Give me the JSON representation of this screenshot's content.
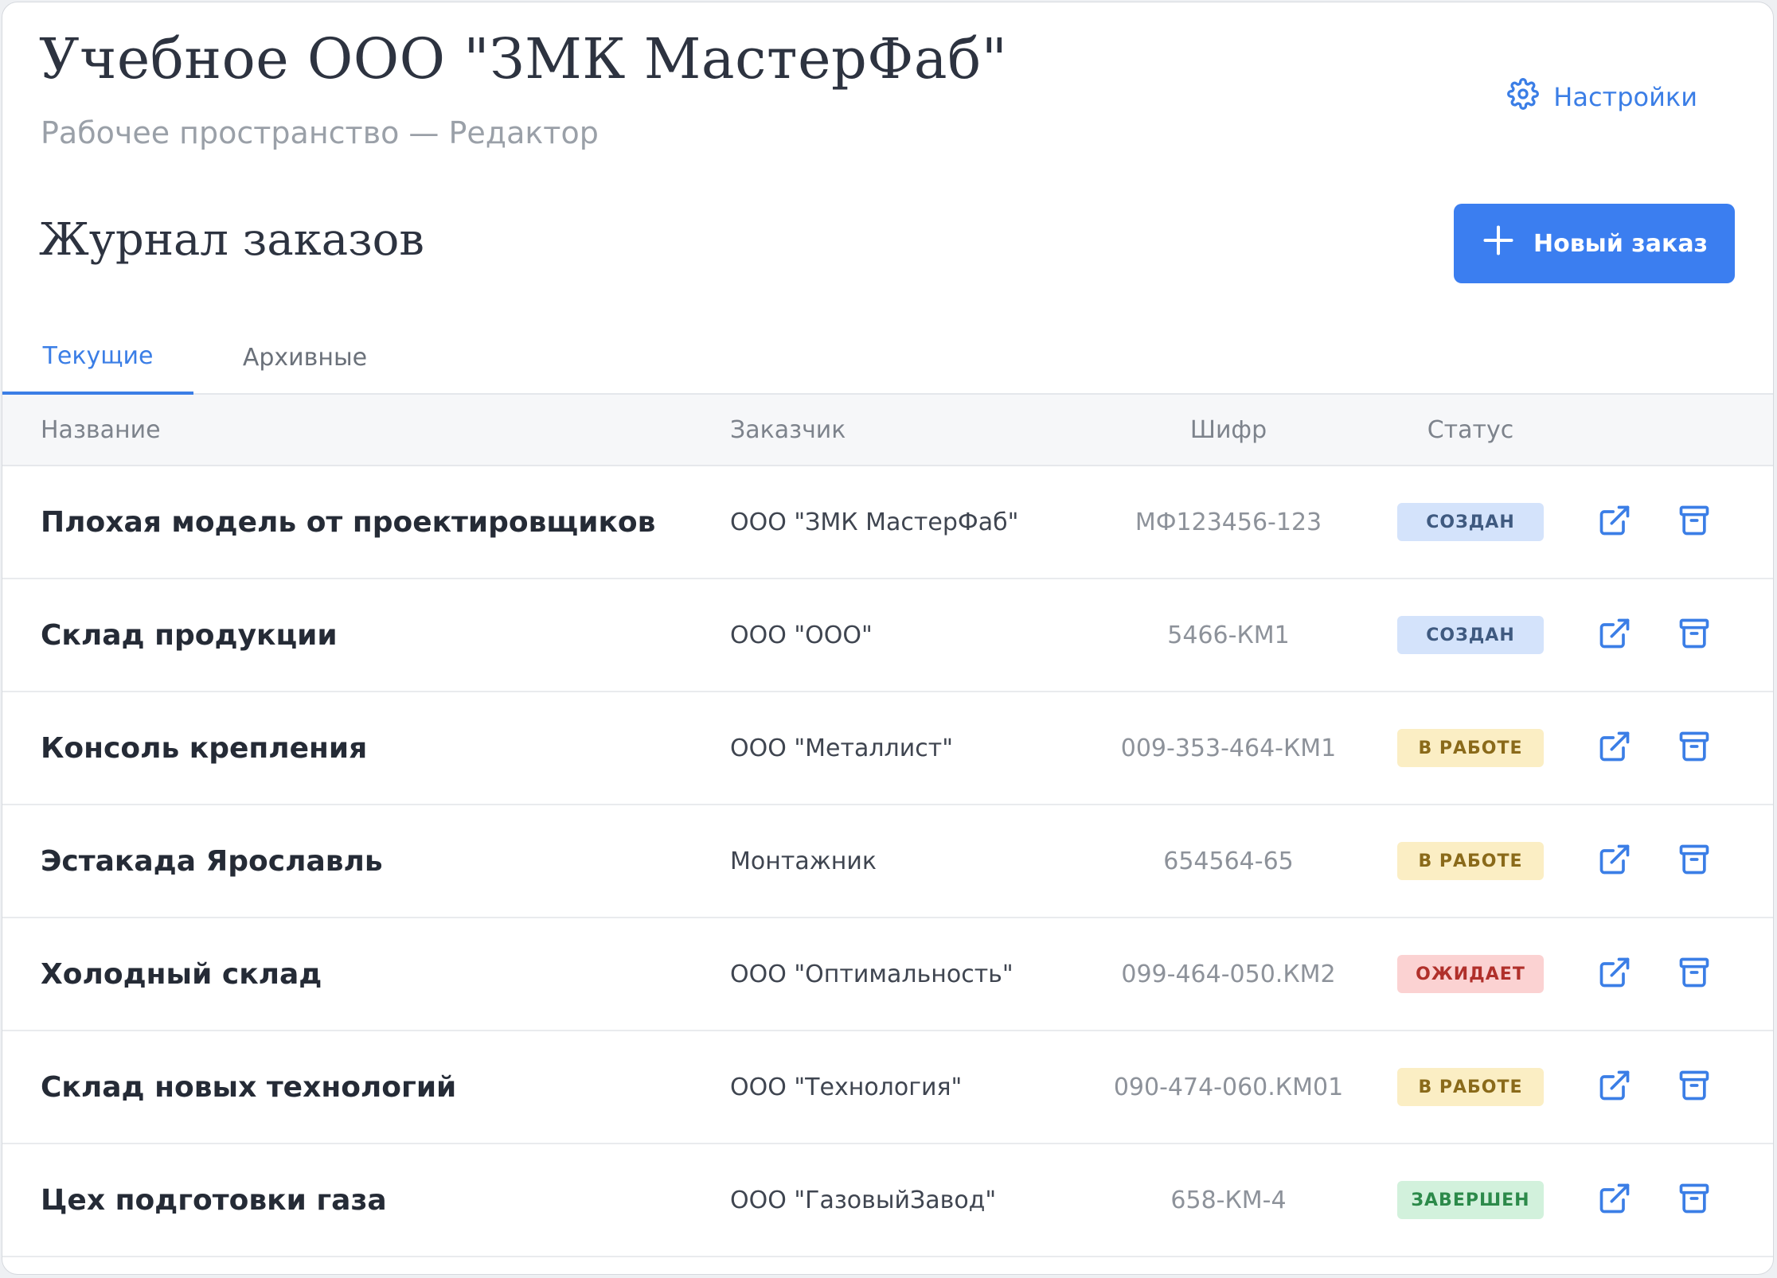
{
  "header": {
    "title": "Учебное ООО \"ЗМК МастерФаб\"",
    "subtitle": "Рабочее пространство — Редактор",
    "settings_label": "Настройки"
  },
  "section": {
    "title": "Журнал заказов",
    "new_order_label": "Новый заказ"
  },
  "tabs": [
    {
      "label": "Текущие",
      "active": true
    },
    {
      "label": "Архивные",
      "active": false
    }
  ],
  "table": {
    "columns": [
      "Название",
      "Заказчик",
      "Шифр",
      "Статус"
    ],
    "rows": [
      {
        "name": "Плохая модель от проектировщиков",
        "customer": "ООО \"ЗМК МастерФаб\"",
        "code": "МФ123456-123",
        "status": "СОЗДАН",
        "status_kind": "created"
      },
      {
        "name": "Склад продукции",
        "customer": "ООО \"ООО\"",
        "code": "5466-КМ1",
        "status": "СОЗДАН",
        "status_kind": "created"
      },
      {
        "name": "Консоль крепления",
        "customer": "ООО \"Металлист\"",
        "code": "009-353-464-КМ1",
        "status": "В РАБОТЕ",
        "status_kind": "inwork"
      },
      {
        "name": "Эстакада Ярославль",
        "customer": "Монтажник",
        "code": "654564-65",
        "status": "В РАБОТЕ",
        "status_kind": "inwork"
      },
      {
        "name": "Холодный склад",
        "customer": "ООО \"Оптимальность\"",
        "code": "099-464-050.КМ2",
        "status": "ОЖИДАЕТ",
        "status_kind": "waiting"
      },
      {
        "name": "Склад новых технологий",
        "customer": "ООО \"Технология\"",
        "code": "090-474-060.КМ01",
        "status": "В РАБОТЕ",
        "status_kind": "inwork"
      },
      {
        "name": "Цех подготовки газа",
        "customer": "ООО \"ГазовыйЗавод\"",
        "code": "658-КМ-4",
        "status": "ЗАВЕРШЕН",
        "status_kind": "done"
      }
    ]
  },
  "icons": {
    "settings": "gear-icon",
    "new_order": "plus-icon",
    "open": "external-link-icon",
    "archive": "archive-icon"
  },
  "colors": {
    "accent": "#3b7ef0",
    "created_bg": "#d4e3fb",
    "inwork_bg": "#fbeec4",
    "waiting_bg": "#fbd2d2",
    "done_bg": "#d2f1dc"
  }
}
